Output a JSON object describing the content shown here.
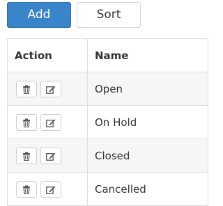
{
  "toolbar": {
    "add_label": "Add",
    "sort_label": "Sort"
  },
  "table": {
    "columns": [
      "Action",
      "Name"
    ],
    "rows": [
      {
        "name": "Open"
      },
      {
        "name": "On Hold"
      },
      {
        "name": "Closed"
      },
      {
        "name": "Cancelled"
      }
    ]
  },
  "icons": {
    "delete": "trash-icon",
    "edit": "edit-icon"
  },
  "colors": {
    "primary": "#3a84c9",
    "row_alt": "#f6f6f6",
    "border": "#dddddd"
  }
}
